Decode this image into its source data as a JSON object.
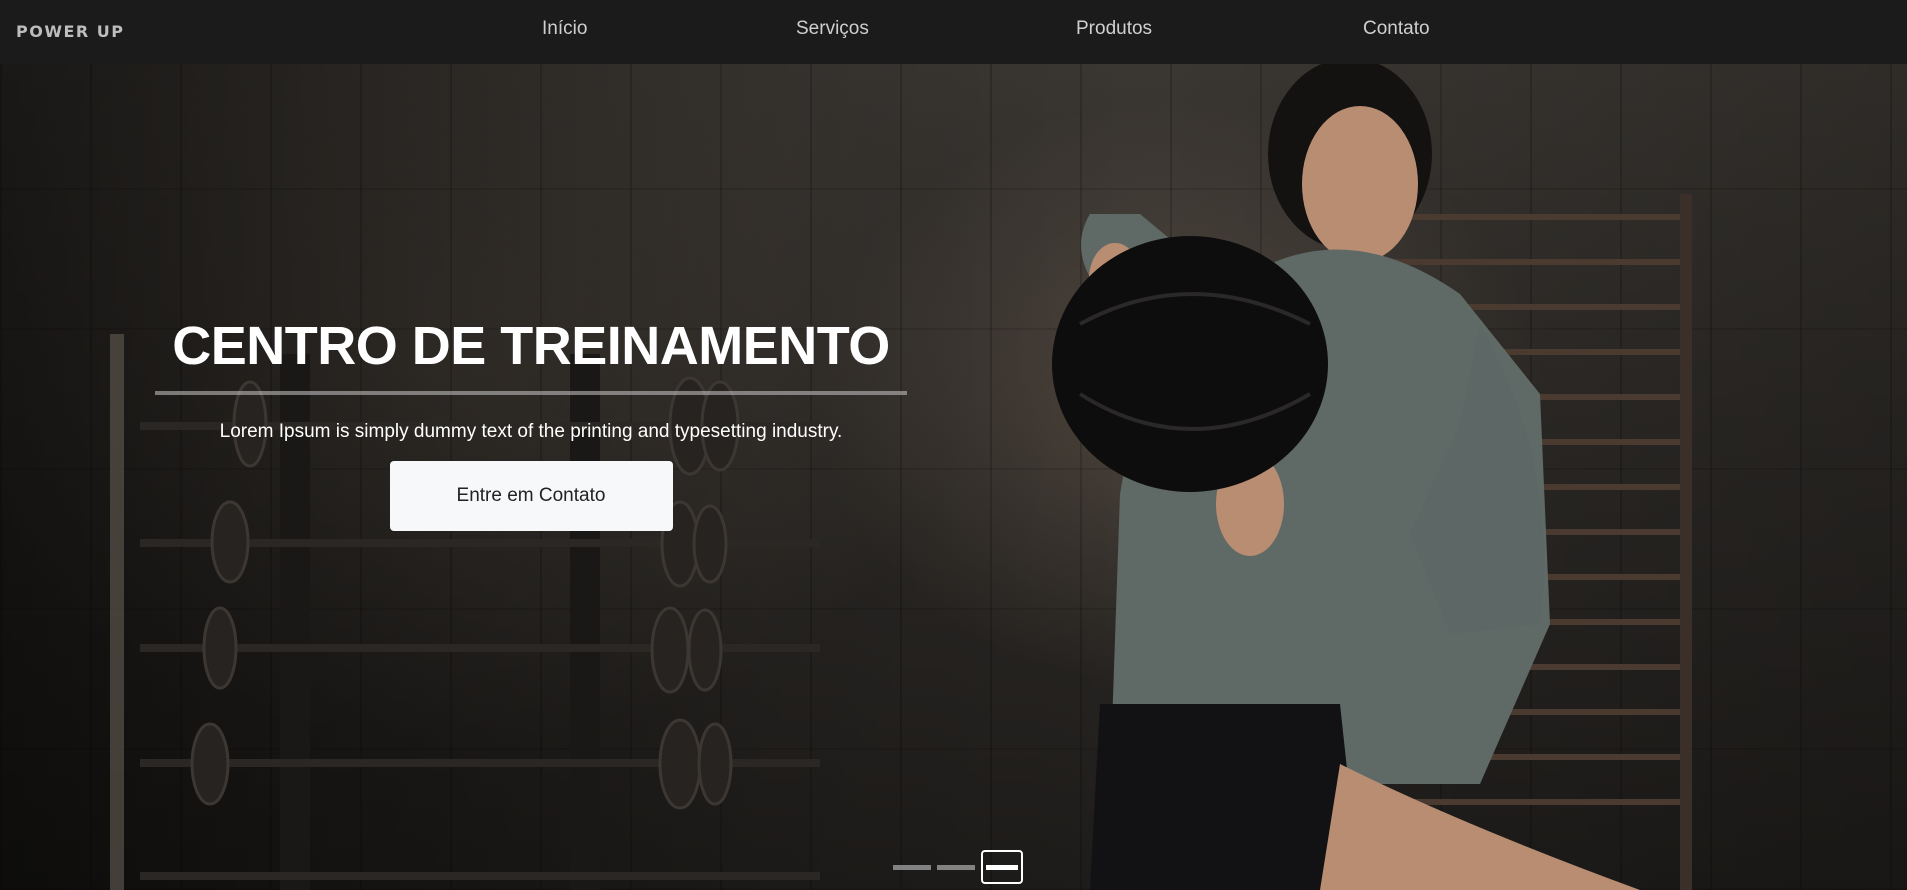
{
  "navbar": {
    "brand": "POWER UP",
    "links": [
      {
        "label": "Início"
      },
      {
        "label": "Serviços"
      },
      {
        "label": "Produtos"
      },
      {
        "label": "Contato"
      }
    ]
  },
  "hero": {
    "title": "CENTRO DE TREINAMENTO",
    "subtitle": "Lorem Ipsum is simply dummy text of the printing and typesetting industry.",
    "button_label": "Entre em Contato"
  },
  "carousel": {
    "slide_count": 3,
    "active_index": 2
  },
  "colors": {
    "navbar_bg": "#1b1b1b",
    "button_bg": "#f7f8fa",
    "title_text": "#ffffff"
  }
}
